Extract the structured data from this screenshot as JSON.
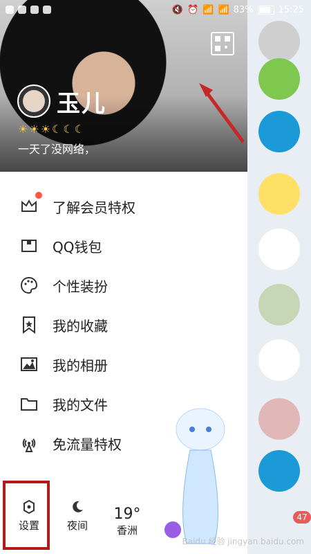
{
  "status": {
    "battery": "83%",
    "time": "15:25"
  },
  "profile": {
    "name": "玉儿",
    "levels": "☀☀☀☾☾☾",
    "signature": "一天了没网络，"
  },
  "menu": [
    {
      "label": "了解会员特权",
      "icon": "crown-icon"
    },
    {
      "label": "QQ钱包",
      "icon": "wallet-icon"
    },
    {
      "label": "个性装扮",
      "icon": "palette-icon"
    },
    {
      "label": "我的收藏",
      "icon": "bookmark-icon"
    },
    {
      "label": "我的相册",
      "icon": "image-icon"
    },
    {
      "label": "我的文件",
      "icon": "folder-icon"
    },
    {
      "label": "免流量特权",
      "icon": "signal-icon"
    }
  ],
  "bottom": {
    "settings": "设置",
    "night": "夜间",
    "weather_temp": "19°",
    "weather_city": "香洲"
  },
  "right": {
    "badge": "47"
  },
  "watermark": "Baidu 经验 jingyan.baidu.com"
}
